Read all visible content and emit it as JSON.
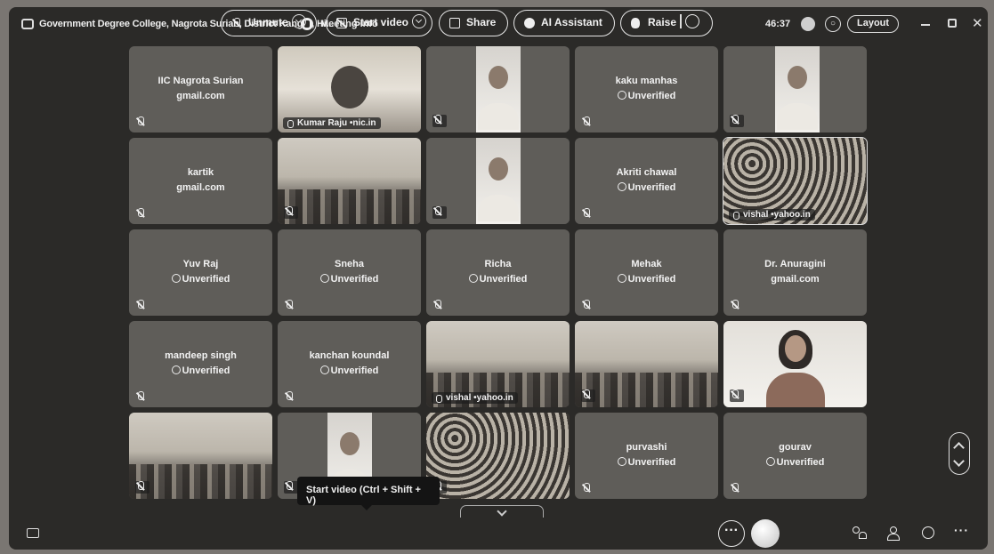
{
  "window": {
    "title": "Government Degree College, Nagrota Surian, District Kangra, Hi...",
    "meeting_info": "Meeting info",
    "timer": "46:37",
    "layout_label": "Layout"
  },
  "participants": [
    {
      "name": "IIC Nagrota Surian",
      "sub": "gmail.com",
      "type": "name"
    },
    {
      "label": "Kumar Raju •nic.in",
      "type": "video",
      "video": "office"
    },
    {
      "type": "video",
      "video": "person"
    },
    {
      "name": "kaku manhas",
      "sub": "Unverified",
      "type": "unverified"
    },
    {
      "type": "video",
      "video": "person2"
    },
    {
      "name": "kartik",
      "sub": "gmail.com",
      "type": "name"
    },
    {
      "type": "video",
      "video": "room"
    },
    {
      "type": "video",
      "video": "person"
    },
    {
      "name": "Akriti chawal",
      "sub": "Unverified",
      "type": "unverified"
    },
    {
      "label": "vishal •yahoo.in",
      "type": "video",
      "video": "crowd",
      "selected": true
    },
    {
      "name": "Yuv Raj",
      "sub": "Unverified",
      "type": "unverified"
    },
    {
      "name": "Sneha",
      "sub": "Unverified",
      "type": "unverified"
    },
    {
      "name": "Richa",
      "sub": "Unverified",
      "type": "unverified"
    },
    {
      "name": "Mehak",
      "sub": "Unverified",
      "type": "unverified"
    },
    {
      "name": "Dr. Anuragini",
      "sub": "gmail.com",
      "type": "name"
    },
    {
      "name": "mandeep singh",
      "sub": "Unverified",
      "type": "unverified"
    },
    {
      "name": "kanchan koundal",
      "sub": "Unverified",
      "type": "unverified"
    },
    {
      "label": "vishal •yahoo.in",
      "type": "video",
      "video": "room"
    },
    {
      "type": "video",
      "video": "room"
    },
    {
      "type": "video",
      "video": "woman"
    },
    {
      "type": "video",
      "video": "room"
    },
    {
      "type": "video",
      "video": "person"
    },
    {
      "type": "video",
      "video": "crowd"
    },
    {
      "name": "purvashi",
      "sub": "Unverified",
      "type": "unverified"
    },
    {
      "name": "gourav",
      "sub": "Unverified",
      "type": "unverified"
    }
  ],
  "tooltip": "Start video (Ctrl + Shift + V)",
  "toolbar": {
    "unmute": "Unmute",
    "start_video": "Start video",
    "share": "Share",
    "ai_assistant": "AI Assistant",
    "raise": "Raise",
    "more": "···",
    "overflow": "···"
  }
}
